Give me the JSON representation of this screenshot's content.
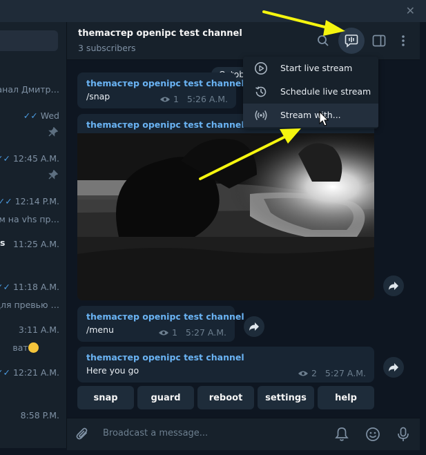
{
  "window": {
    "close_glyph": "✕"
  },
  "sidebar": {
    "chats": [
      {
        "preview": "анал Дмитр…"
      },
      {
        "time": "Wed",
        "ticks": "✓✓",
        "pinned": true
      },
      {
        "time": "12:45 A.M.",
        "ticks": "✓✓",
        "pinned": true
      },
      {
        "time": "12:14 P.M.",
        "ticks": "✓✓",
        "preview": "ом на vhs пр…"
      },
      {
        "name_fragment": "s",
        "time": "11:25 A.M."
      },
      {
        "time": "11:18 A.M.",
        "ticks": "✓✓",
        "preview": "для превью …"
      },
      {
        "time": "3:11 A.M.",
        "preview": "вать.. "
      },
      {
        "time": "12:21 A.M.",
        "ticks": "✓✓"
      },
      {
        "time": "8:58 P.M."
      }
    ]
  },
  "header": {
    "title": "themacтep openipc test channel",
    "subtitle": "3 subscribers",
    "icons": [
      "search-icon",
      "live-stream-icon",
      "sidebar-toggle-icon",
      "more-vertical-icon"
    ]
  },
  "menu": {
    "items": [
      {
        "label": "Start live stream",
        "icon": "play-circle-icon"
      },
      {
        "label": "Schedule live stream",
        "icon": "history-icon"
      },
      {
        "label": "Stream with...",
        "icon": "broadcast-icon"
      }
    ]
  },
  "messages": {
    "date_pill": "Octob",
    "m1": {
      "sender": "themacтep openipc test channel",
      "text": "/snap",
      "views": "1",
      "time": "5:26 A.M."
    },
    "m2": {
      "sender": "themacтep openipc test channel"
    },
    "m3": {
      "sender": "themacтep openipc test channel",
      "text": "/menu",
      "views": "1",
      "time": "5:27 A.M."
    },
    "m4": {
      "sender": "themacтep openipc test channel",
      "text": "Here you go",
      "views": "2",
      "time": "5:27 A.M."
    }
  },
  "keyboard": {
    "buttons": [
      "snap",
      "guard",
      "reboot",
      "settings",
      "help"
    ]
  },
  "composer": {
    "placeholder": "Broadcast a message..."
  },
  "colors": {
    "accent": "#6ab3f3",
    "annotation": "#f5f50f"
  }
}
